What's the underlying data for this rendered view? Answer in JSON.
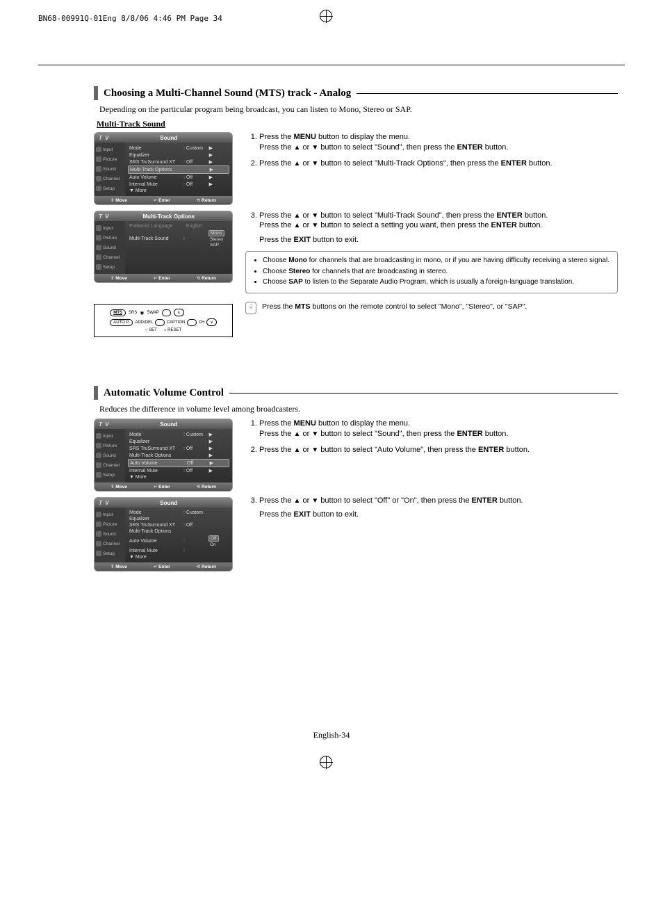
{
  "header_line": "BN68-00991Q-01Eng  8/8/06  4:46 PM  Page 34",
  "section1": {
    "title": "Choosing a Multi-Channel Sound (MTS) track - Analog",
    "intro": "Depending on the particular program being broadcast, you can listen to Mono, Stereo or SAP.",
    "subhead": "Multi-Track Sound",
    "steps": [
      {
        "num": "1.",
        "a": "Press the ",
        "b": "MENU",
        "c": " button to display the menu.",
        "d": "Press the ",
        "e": " or ",
        "f": " button to select \"Sound\", then press the ",
        "g": "ENTER",
        "h": " button."
      },
      {
        "num": "2.",
        "a": "Press the ",
        "e": " or ",
        "f": " button to select \"Multi-Track Options\", then press the ",
        "g": "ENTER",
        "h": " button."
      },
      {
        "num": "3.",
        "a": "Press the ",
        "e": " or ",
        "f": " button to select \"Multi-Track Sound\", then press the ",
        "g": "ENTER",
        "h": " button.",
        "d2": "Press the ",
        "e2": " or ",
        "f2": " button to select a setting you want, then press the ",
        "g2": "ENTER",
        "h2": " button.",
        "exit": "Press the ",
        "exitb": "EXIT",
        "exitc": " button to exit."
      }
    ],
    "tips": [
      {
        "a": "Choose ",
        "b": "Mono",
        "c": " for channels that are broadcasting in mono, or if you are having difficulty receiving a stereo signal."
      },
      {
        "a": "Choose ",
        "b": "Stereo",
        "c": " for channels that are broadcasting in stereo."
      },
      {
        "a": "Choose ",
        "b": "SAP",
        "c": " to listen to the Separate Audio Program, which is usually a foreign-language translation."
      }
    ],
    "remote_tip": {
      "a": "Press the ",
      "b": "MTS",
      "c": " buttons on the remote control to select \"Mono\", \"Stereo\", or \"SAP\"."
    }
  },
  "section2": {
    "title": "Automatic Volume Control",
    "intro": "Reduces the difference in volume level among broadcasters.",
    "steps": [
      {
        "num": "1.",
        "a": "Press the ",
        "b": "MENU",
        "c": " button to display the menu.",
        "d": "Press the ",
        "e": " or ",
        "f": " button to select \"Sound\", then press the ",
        "g": "ENTER",
        "h": " button."
      },
      {
        "num": "2.",
        "a": "Press the ",
        "e": " or ",
        "f": " button to select \"Auto Volume\", then press the ",
        "g": "ENTER",
        "h": " button."
      },
      {
        "num": "3.",
        "a": "Press the ",
        "e": " or ",
        "f": " button to select \"Off\" or \"On\", then press the ",
        "g": "ENTER",
        "h": " button.",
        "exit": "Press the ",
        "exitb": "EXIT",
        "exitc": " button to exit."
      }
    ]
  },
  "osd_sound1": {
    "tv": "T V",
    "title": "Sound",
    "side": [
      "Input",
      "Picture",
      "Sound",
      "Channel",
      "Setup"
    ],
    "rows": [
      {
        "lbl": "Mode",
        "val": ": Custom",
        "ar": "▶"
      },
      {
        "lbl": "Equalizer",
        "val": "",
        "ar": "▶"
      },
      {
        "lbl": "SRS TruSurround XT",
        "val": ": Off",
        "ar": "▶"
      },
      {
        "lbl": "Multi-Track Options",
        "val": "",
        "ar": "▶",
        "hl": true
      },
      {
        "lbl": "Auto Volume",
        "val": ": Off",
        "ar": "▶"
      },
      {
        "lbl": "Internal Mute",
        "val": ": Off",
        "ar": "▶"
      },
      {
        "lbl": "▼ More",
        "val": "",
        "ar": ""
      }
    ],
    "foot": [
      "Move",
      "Enter",
      "Return"
    ]
  },
  "osd_mts": {
    "tv": "T V",
    "title": "Multi-Track Options",
    "side": [
      "Input",
      "Picture",
      "Sound",
      "Channel",
      "Setup"
    ],
    "rows": [
      {
        "lbl": "Preferred Language",
        "val": ": English",
        "ar": "",
        "disabled": true
      },
      {
        "lbl": "Multi-Track Sound",
        "val": ":",
        "opts": [
          "Mono",
          "Stereo",
          "SAP"
        ],
        "sel": 0
      }
    ],
    "foot": [
      "Move",
      "Enter",
      "Return"
    ]
  },
  "remote_buttons": {
    "row1": [
      "MTS",
      "SRS",
      "SWAP"
    ],
    "row2": [
      "AUTO P.",
      "ADD/DEL",
      "CAPTION",
      "CH"
    ],
    "row3": [
      "SET",
      "RESET"
    ],
    "arrows": [
      "∧",
      "∨"
    ],
    "dot": "◉"
  },
  "osd_sound2": {
    "tv": "T V",
    "title": "Sound",
    "side": [
      "Input",
      "Picture",
      "Sound",
      "Channel",
      "Setup"
    ],
    "rows": [
      {
        "lbl": "Mode",
        "val": ": Custom",
        "ar": "▶"
      },
      {
        "lbl": "Equalizer",
        "val": "",
        "ar": "▶"
      },
      {
        "lbl": "SRS TruSurround XT",
        "val": ": Off",
        "ar": "▶"
      },
      {
        "lbl": "Multi-Track Options",
        "val": "",
        "ar": "▶"
      },
      {
        "lbl": "Auto Volume",
        "val": ": Off",
        "ar": "▶",
        "hl": true
      },
      {
        "lbl": "Internal Mute",
        "val": ": Off",
        "ar": "▶"
      },
      {
        "lbl": "▼ More",
        "val": "",
        "ar": ""
      }
    ],
    "foot": [
      "Move",
      "Enter",
      "Return"
    ]
  },
  "osd_sound3": {
    "tv": "T V",
    "title": "Sound",
    "side": [
      "Input",
      "Picture",
      "Sound",
      "Channel",
      "Setup"
    ],
    "rows": [
      {
        "lbl": "Mode",
        "val": ": Custom",
        "ar": ""
      },
      {
        "lbl": "Equalizer",
        "val": "",
        "ar": ""
      },
      {
        "lbl": "SRS TruSurround XT",
        "val": ": Off",
        "ar": ""
      },
      {
        "lbl": "Multi-Track Options",
        "val": "",
        "ar": ""
      },
      {
        "lbl": "Auto Volume",
        "val": ":",
        "opts": [
          "Off",
          "On"
        ],
        "sel": 0
      },
      {
        "lbl": "Internal Mute",
        "val": ":",
        "ar": ""
      },
      {
        "lbl": "▼ More",
        "val": "",
        "ar": ""
      }
    ],
    "foot": [
      "Move",
      "Enter",
      "Return"
    ]
  },
  "page_foot": "English-34"
}
